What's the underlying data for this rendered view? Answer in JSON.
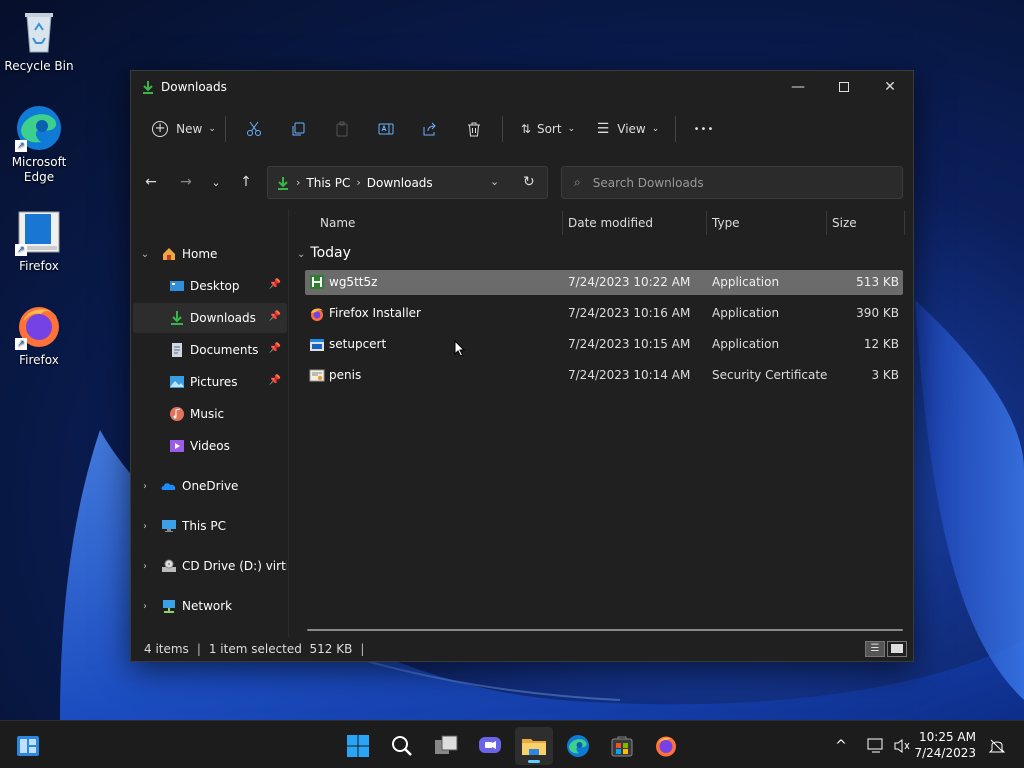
{
  "desktop": {
    "icons": [
      {
        "label": "Recycle Bin"
      },
      {
        "label": "Microsoft Edge"
      },
      {
        "label": "Firefox"
      },
      {
        "label": "Firefox"
      }
    ]
  },
  "window": {
    "title": "Downloads",
    "controls": [
      "minimize-icon",
      "maximize-icon",
      "close-icon"
    ]
  },
  "commandbar": {
    "new_label": "New",
    "sort_label": "Sort",
    "view_label": "View",
    "more_label": "•••"
  },
  "address": {
    "segments": [
      "This PC",
      "Downloads"
    ],
    "search_placeholder": "Search Downloads"
  },
  "navpane": {
    "items": [
      {
        "label": "Home",
        "icon": "home-icon",
        "expanded": true
      },
      {
        "label": "Desktop",
        "icon": "desktop-icon",
        "pinned": true
      },
      {
        "label": "Downloads",
        "icon": "download-icon",
        "pinned": true,
        "selected": true
      },
      {
        "label": "Documents",
        "icon": "documents-icon",
        "pinned": true
      },
      {
        "label": "Pictures",
        "icon": "pictures-icon",
        "pinned": true
      },
      {
        "label": "Music",
        "icon": "music-icon"
      },
      {
        "label": "Videos",
        "icon": "videos-icon"
      },
      {
        "label": "OneDrive",
        "icon": "onedrive-icon"
      },
      {
        "label": "This PC",
        "icon": "this-pc-icon"
      },
      {
        "label": "CD Drive (D:) virtio-w",
        "icon": "cd-drive-icon"
      },
      {
        "label": "Network",
        "icon": "network-icon"
      }
    ]
  },
  "filelist": {
    "columns": [
      "Name",
      "Date modified",
      "Type",
      "Size"
    ],
    "group": "Today",
    "rows": [
      {
        "name": "wg5tt5z",
        "date": "7/24/2023 10:22 AM",
        "type": "Application",
        "size": "513 KB",
        "selected": true
      },
      {
        "name": "Firefox Installer",
        "date": "7/24/2023 10:16 AM",
        "type": "Application",
        "size": "390 KB"
      },
      {
        "name": "setupcert",
        "date": "7/24/2023 10:15 AM",
        "type": "Application",
        "size": "12 KB"
      },
      {
        "name": "penis",
        "date": "7/24/2023 10:14 AM",
        "type": "Security Certificate",
        "size": "3 KB"
      }
    ]
  },
  "status": {
    "items": "4 items",
    "selection": "1 item selected  512 KB"
  },
  "taskbar": {
    "time": "10:25 AM",
    "date": "7/24/2023"
  },
  "colors": {
    "accent": "#60cdff",
    "download_green": "#3bb54a",
    "folder_yellow": "#f2c04d"
  }
}
